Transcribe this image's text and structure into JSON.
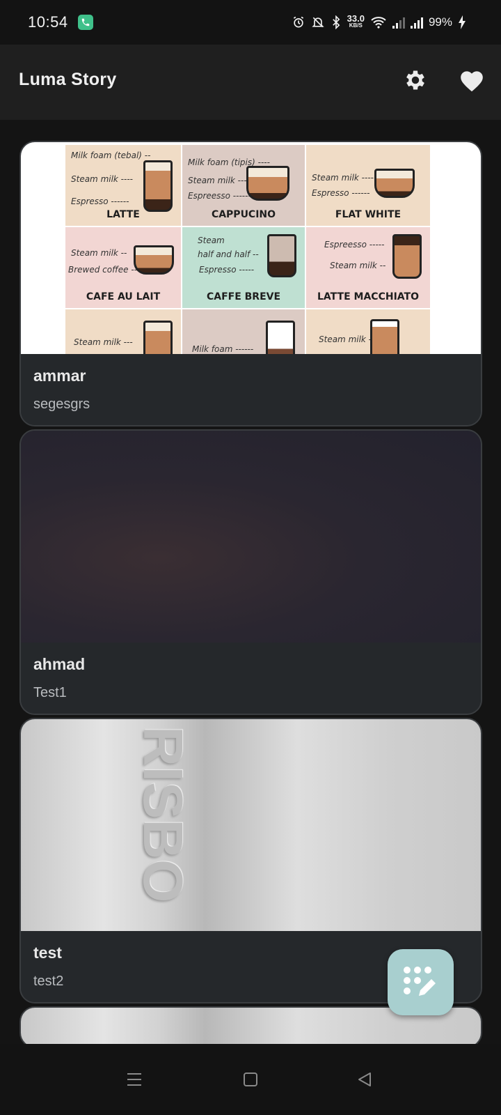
{
  "status_bar": {
    "time": "10:54",
    "net_speed": "33.0",
    "net_unit": "KB/S",
    "battery": "99%"
  },
  "app_bar": {
    "title": "Luma Story",
    "settings_icon": "gear-icon",
    "favorites_icon": "heart-icon"
  },
  "posts": [
    {
      "author": "ammar",
      "text": "segesgrs",
      "image": {
        "type": "coffee-chart",
        "drinks": [
          "LATTE",
          "CAPPUCINO",
          "FLAT WHITE",
          "CAFE AU LAIT",
          "CAFFE BREVE",
          "LATTE MACCHIATO"
        ],
        "labels": {
          "latte": [
            "Milk foam (tebal) --",
            "Steam milk ----",
            "Espresso ------"
          ],
          "cappucino": [
            "Milk foam (tipis) ----",
            "Steam milk ---",
            "Espreesso ------"
          ],
          "flat_white": [
            "Steam milk ----",
            "Espresso ------"
          ],
          "cafe_au_lait": [
            "Steam milk --",
            "Brewed coffee --"
          ],
          "caffe_breve": [
            "Steam",
            "half and half --",
            "Espresso -----"
          ],
          "latte_macchiato": [
            "Espreesso -----",
            "Steam milk --"
          ],
          "row3": [
            "Steam milk ---",
            "Milk foam ------",
            "Steam milk ---"
          ]
        }
      }
    },
    {
      "author": "ahmad",
      "text": "Test1",
      "image": {
        "type": "dark-photo"
      }
    },
    {
      "author": "test",
      "text": "test2",
      "image": {
        "type": "grey-bottle-photo",
        "embossed_text": "RISBO"
      }
    }
  ],
  "fab": {
    "icon": "dialpad-edit-icon"
  },
  "nav": {
    "menu_icon": "menu-icon",
    "home_icon": "home-square-icon",
    "back_icon": "back-triangle-icon"
  },
  "colors": {
    "background": "#141414",
    "app_bar": "#1f1f1f",
    "card": "#25282b",
    "fab": "#a8cfcf",
    "call_badge": "#3fc08a"
  }
}
